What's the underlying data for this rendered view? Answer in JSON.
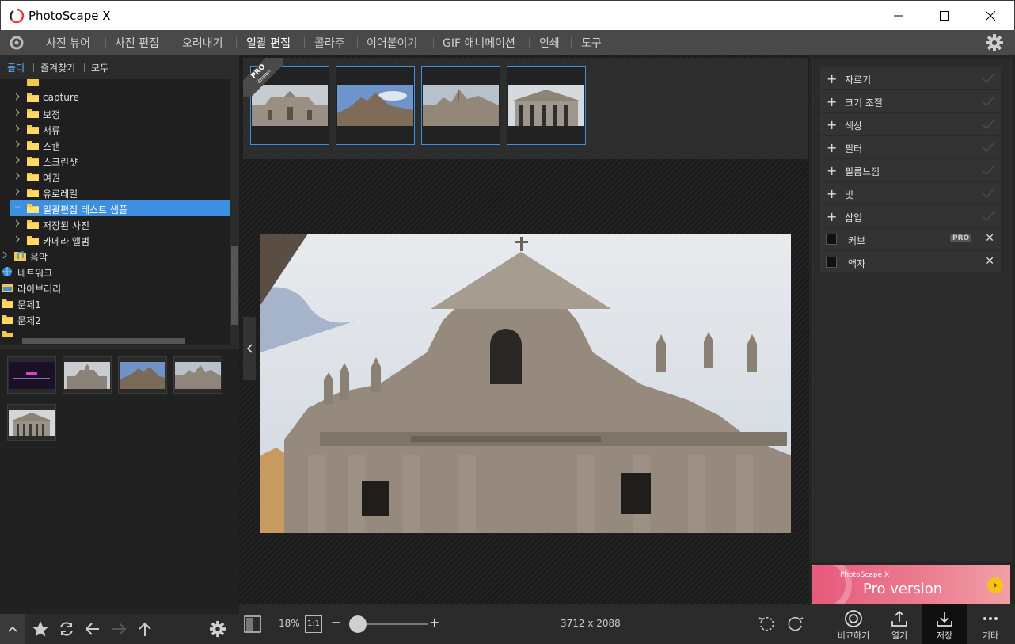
{
  "window": {
    "title": "PhotoScape X",
    "minimize_label": "—",
    "maximize_label": "☐",
    "close_label": "✕"
  },
  "menu": {
    "items": [
      "사진 뷰어",
      "사진 편집",
      "오려내기",
      "일괄 편집",
      "콜라주",
      "이어붙이기",
      "GIF 애니메이션",
      "인쇄",
      "도구"
    ],
    "active_index": 3
  },
  "left_tabs": [
    "폴더",
    "즐겨찾기",
    "모두"
  ],
  "tree": [
    {
      "label": "capture"
    },
    {
      "label": "보정"
    },
    {
      "label": "서류"
    },
    {
      "label": "스캔"
    },
    {
      "label": "스크린샷"
    },
    {
      "label": "여권"
    },
    {
      "label": "유로레일"
    },
    {
      "label": "일괄편집 테스트 샘플",
      "selected": true
    },
    {
      "label": "저장된 사진"
    },
    {
      "label": "카메라 앨범"
    },
    {
      "label": "음악"
    },
    {
      "label": "네트워크"
    },
    {
      "label": "라이브러리"
    },
    {
      "label": "문제1"
    },
    {
      "label": "문제2"
    }
  ],
  "strip": {
    "pro_badge": "PRO",
    "pro_badge_sub": "Version"
  },
  "right_tools": [
    {
      "label": "자르기"
    },
    {
      "label": "크기 조절"
    },
    {
      "label": "색상"
    },
    {
      "label": "필터"
    },
    {
      "label": "필름느낌"
    },
    {
      "label": "빛"
    },
    {
      "label": "삽입"
    }
  ],
  "right_checks": [
    {
      "label": "커브",
      "pro": "PRO"
    },
    {
      "label": "액자"
    }
  ],
  "promo": {
    "sub": "PhotoScape X",
    "title": "Pro version",
    "arrow": "›"
  },
  "bottom": {
    "zoom": "18%",
    "ratio_label": "1:1",
    "minus": "−",
    "plus": "+",
    "dimensions": "3712 x 2088",
    "actions": [
      {
        "label": "비교하기"
      },
      {
        "label": "열기"
      },
      {
        "label": "저장"
      },
      {
        "label": "기타"
      }
    ]
  },
  "colors": {
    "accent": "#3d8fe0",
    "menu_bg": "#494949",
    "panel_bg": "#2b2b2b"
  }
}
